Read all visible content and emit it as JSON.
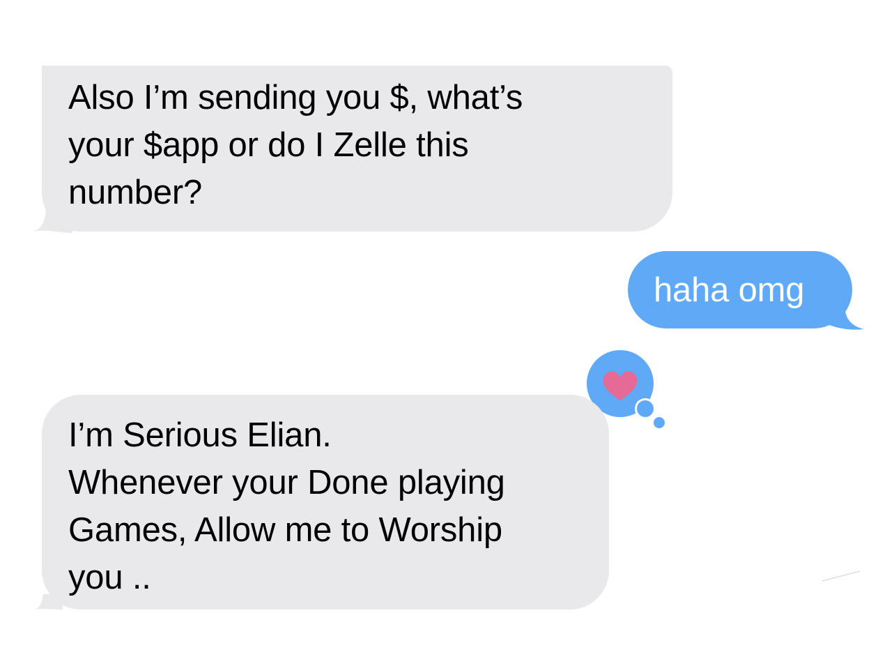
{
  "messages": [
    {
      "direction": "received",
      "text": "Also I’m sending you $, what’s\nyour $app or do I Zelle this\nnumber?"
    },
    {
      "direction": "sent",
      "text": "haha omg"
    },
    {
      "direction": "received",
      "text": "I’m Serious Elian.\nWhenever your Done playing\nGames, Allow me to Worship\nyou .."
    }
  ],
  "reaction": {
    "type": "heart-icon",
    "color": "#e56a95",
    "badge_color": "#5fa9f6"
  },
  "colors": {
    "received_bubble": "#e9e9eb",
    "sent_bubble": "#5fa9f6",
    "background": "#ffffff"
  }
}
